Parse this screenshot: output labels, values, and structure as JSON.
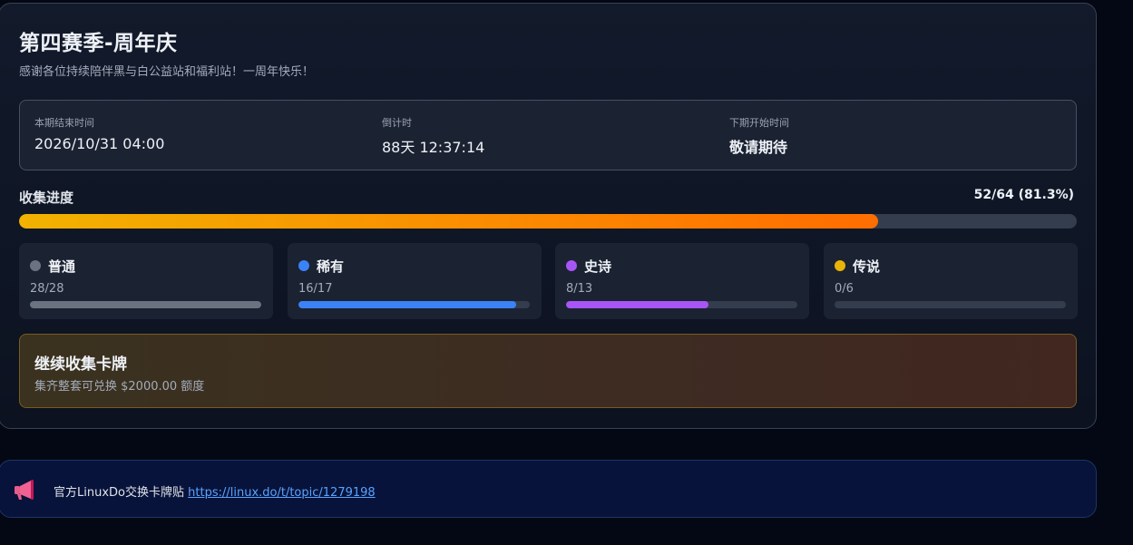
{
  "season": {
    "title": "第四赛季-周年庆",
    "subtitle": "感谢各位持续陪伴黑与白公益站和福利站！一周年快乐！"
  },
  "info": {
    "end_label": "本期结束时间",
    "end_value": "2026/10/31 04:00",
    "countdown_label": "倒计时",
    "countdown_value": "88天 12:37:14",
    "next_label": "下期开始时间",
    "next_value": "敬请期待"
  },
  "progress": {
    "label": "收集进度",
    "count_text": "52/64 (81.3%)",
    "fraction": 0.8125,
    "fill_colors": [
      "#f2b200",
      "#ff6d00"
    ]
  },
  "rarities": [
    {
      "name": "普通",
      "count": "28/28",
      "fraction": 1.0,
      "color": "#6b7280"
    },
    {
      "name": "稀有",
      "count": "16/17",
      "fraction": 0.941,
      "color": "#3b82f6"
    },
    {
      "name": "史诗",
      "count": "8/13",
      "fraction": 0.615,
      "color": "#a855f7"
    },
    {
      "name": "传说",
      "count": "0/6",
      "fraction": 0.0,
      "color": "#eab308"
    }
  ],
  "reward": {
    "title": "继续收集卡牌",
    "description": "集齐整套可兑换 $2000.00 额度"
  },
  "notice": {
    "icon": "megaphone-icon",
    "text": "官方LinuxDo交换卡牌贴",
    "link_text": "https://linux.do/t/topic/1279198"
  }
}
